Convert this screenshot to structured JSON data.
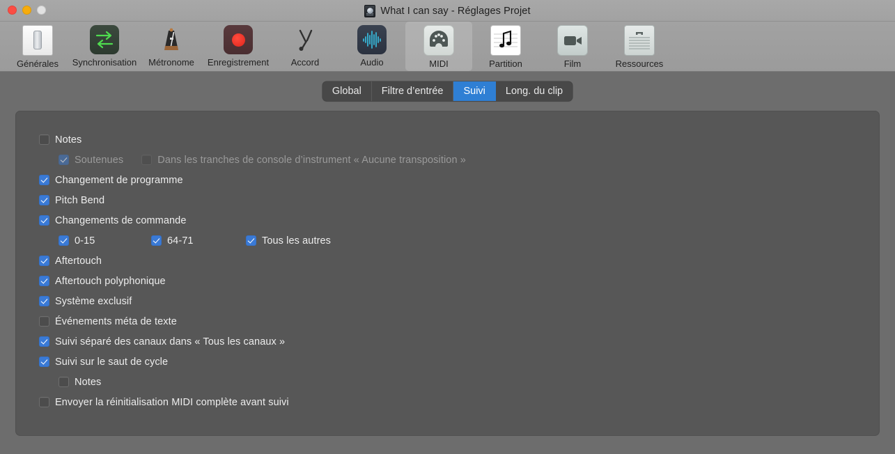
{
  "window": {
    "title": "What I can say - Réglages Projet",
    "doc_icon": "logic-project-document-icon",
    "traffic": {
      "close": "close-button",
      "minimize": "minimize-button",
      "zoom": "zoom-button"
    }
  },
  "toolbar": {
    "items": [
      {
        "label": "Générales",
        "icon": "toggle-switch-icon",
        "selected": false
      },
      {
        "label": "Synchronisation",
        "icon": "sync-arrows-icon",
        "selected": false
      },
      {
        "label": "Métronome",
        "icon": "metronome-icon",
        "selected": false
      },
      {
        "label": "Enregistrement",
        "icon": "record-circle-icon",
        "selected": false
      },
      {
        "label": "Accord",
        "icon": "tuning-fork-icon",
        "selected": false
      },
      {
        "label": "Audio",
        "icon": "waveform-icon",
        "selected": false
      },
      {
        "label": "MIDI",
        "icon": "midi-connector-icon",
        "selected": true
      },
      {
        "label": "Partition",
        "icon": "music-note-icon",
        "selected": false
      },
      {
        "label": "Film",
        "icon": "video-camera-icon",
        "selected": false
      },
      {
        "label": "Ressources",
        "icon": "briefcase-icon",
        "selected": false
      }
    ]
  },
  "tabs": {
    "items": [
      {
        "label": "Global",
        "active": false
      },
      {
        "label": "Filtre d’entrée",
        "active": false
      },
      {
        "label": "Suivi",
        "active": true
      },
      {
        "label": "Long. du clip",
        "active": false
      }
    ]
  },
  "settings": {
    "notes": {
      "label": "Notes",
      "checked": false,
      "enabled": true
    },
    "soutenues": {
      "label": "Soutenues",
      "checked": true,
      "enabled": false
    },
    "tranches_console": {
      "label": "Dans les tranches de console d’instrument « Aucune transposition »",
      "checked": false,
      "enabled": false
    },
    "changement_programme": {
      "label": "Changement de programme",
      "checked": true,
      "enabled": true
    },
    "pitch_bend": {
      "label": "Pitch Bend",
      "checked": true,
      "enabled": true
    },
    "changements_commande": {
      "label": "Changements de commande",
      "checked": true,
      "enabled": true
    },
    "cc_0_15": {
      "label": "0-15",
      "checked": true,
      "enabled": true
    },
    "cc_64_71": {
      "label": "64-71",
      "checked": true,
      "enabled": true
    },
    "cc_tous_autres": {
      "label": "Tous les autres",
      "checked": true,
      "enabled": true
    },
    "aftertouch": {
      "label": "Aftertouch",
      "checked": true,
      "enabled": true
    },
    "aftertouch_poly": {
      "label": "Aftertouch polyphonique",
      "checked": true,
      "enabled": true
    },
    "systeme_exclusif": {
      "label": "Système exclusif",
      "checked": true,
      "enabled": true
    },
    "evenements_meta": {
      "label": "Événements méta de texte",
      "checked": false,
      "enabled": true
    },
    "suivi_separe": {
      "label": "Suivi séparé des canaux dans « Tous les canaux »",
      "checked": true,
      "enabled": true
    },
    "suivi_saut_cycle": {
      "label": "Suivi sur le saut de cycle",
      "checked": true,
      "enabled": true
    },
    "suivi_notes": {
      "label": "Notes",
      "checked": false,
      "enabled": true
    },
    "reinit_midi": {
      "label": "Envoyer la réinitialisation MIDI complète avant suivi",
      "checked": false,
      "enabled": true
    }
  },
  "colors": {
    "accent_blue": "#3a7ad6",
    "tab_blue": "#2f7fd4",
    "panel_bg": "#575757",
    "window_bg": "#6d6d6d",
    "titlebar_bg": "#a2a2a2"
  }
}
